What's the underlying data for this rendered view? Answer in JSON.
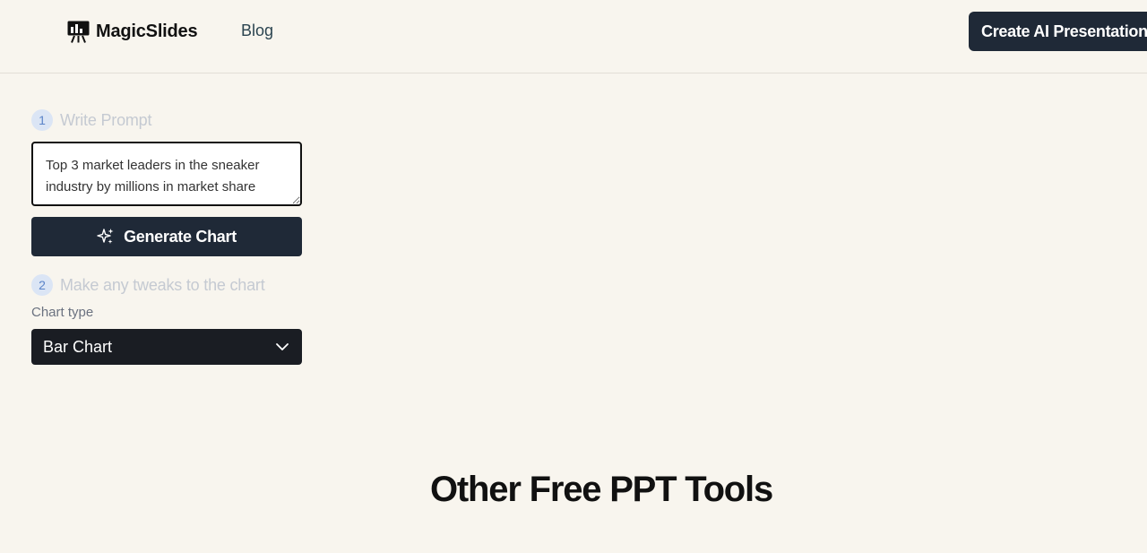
{
  "header": {
    "brand": "MagicSlides",
    "nav_blog": "Blog",
    "cta_label": "Create AI Presentation"
  },
  "steps": [
    {
      "number": "1",
      "label": "Write Prompt"
    },
    {
      "number": "2",
      "label": "Make any tweaks to the chart"
    }
  ],
  "prompt": {
    "value": "Top 3 market leaders in the sneaker industry by millions in market share"
  },
  "generate_button": {
    "label": "Generate Chart",
    "icon": "sparkles-icon"
  },
  "chart_type": {
    "label": "Chart type",
    "selected": "Bar Chart",
    "icon": "chevron-down-icon"
  },
  "section": {
    "title": "Other Free PPT Tools"
  },
  "colors": {
    "background": "#f8f5ee",
    "button_dark": "#1f2937",
    "select_dark": "#1a1d23",
    "step_badge": "#dbe5f5",
    "step_label": "#c5cad2"
  }
}
